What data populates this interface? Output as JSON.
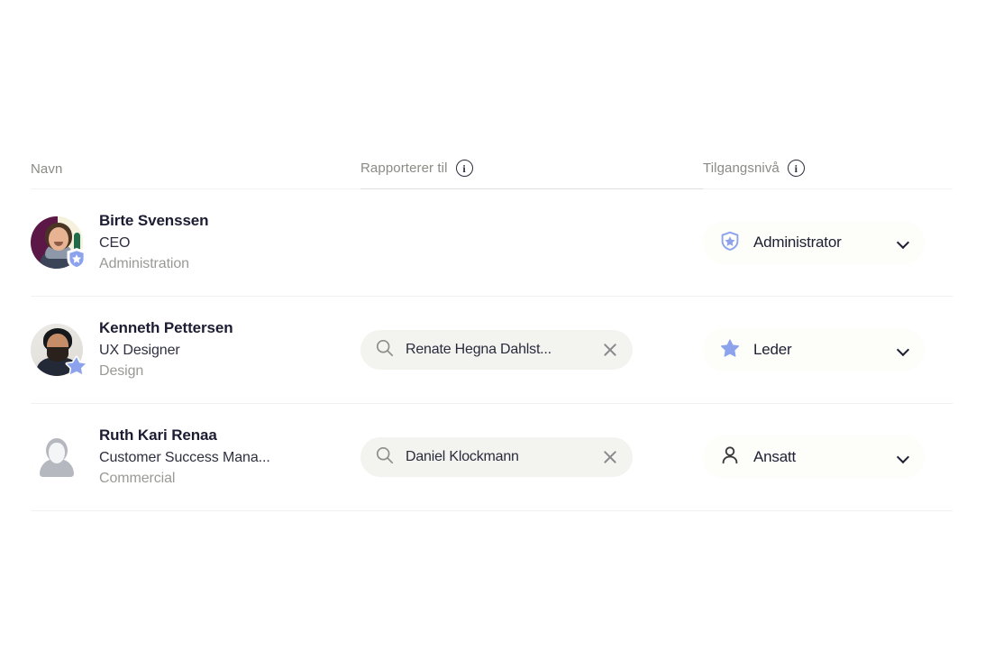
{
  "table": {
    "headers": {
      "name": "Navn",
      "reports_to": "Rapporterer til",
      "access_level": "Tilgangsnivå",
      "info_glyph": "i"
    },
    "rows": [
      {
        "name": "Birte Svenssen",
        "title": "CEO",
        "department": "Administration",
        "avatar": "photo-avatar-birte",
        "badge": "shield-star-badge",
        "reports_to": {
          "value": "",
          "placeholder": "",
          "has_value": false
        },
        "access": {
          "label": "Administrator",
          "icon": "shield-star-icon"
        }
      },
      {
        "name": "Kenneth Pettersen",
        "title": "UX Designer",
        "department": "Design",
        "avatar": "photo-avatar-kenneth",
        "badge": "star-badge",
        "reports_to": {
          "value": "Renate Hegna Dahlst...",
          "placeholder": "",
          "has_value": true
        },
        "access": {
          "label": "Leder",
          "icon": "star-icon"
        }
      },
      {
        "name": "Ruth Kari Renaa",
        "title": "Customer Success Mana...",
        "department": "Commercial",
        "avatar": "placeholder-avatar",
        "badge": "",
        "reports_to": {
          "value": "Daniel Klockmann",
          "placeholder": "",
          "has_value": true
        },
        "access": {
          "label": "Ansatt",
          "icon": "person-icon"
        }
      }
    ]
  },
  "colors": {
    "accent_periwinkle": "#8da2ec",
    "name_text": "#1c1c32",
    "muted_text": "#9a9a94",
    "search_pill_bg": "#f3f3f0",
    "access_pill_bg": "#fdfdfa",
    "row_divider": "#f1f1ef"
  }
}
